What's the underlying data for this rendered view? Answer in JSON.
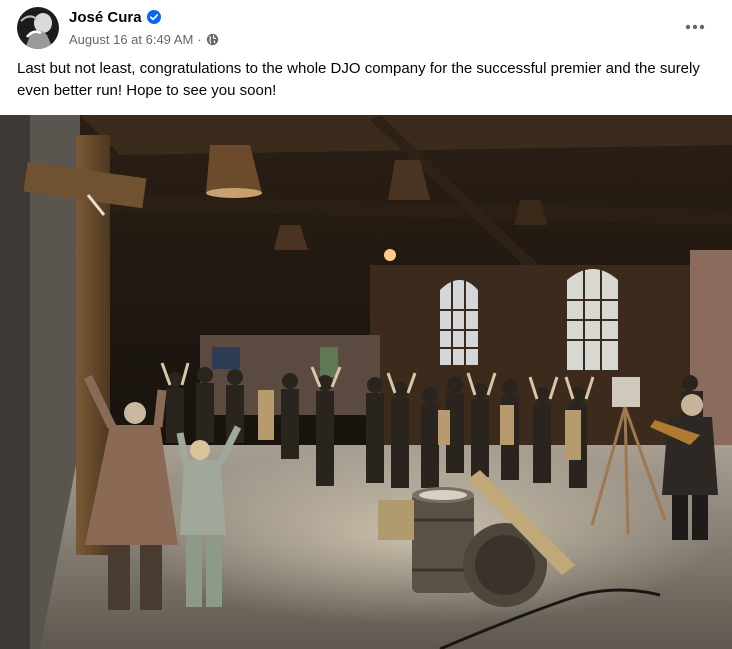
{
  "post": {
    "author": "José Cura",
    "timestamp": "August 16 at 6:49 AM",
    "separator": "·",
    "text": "Last but not least, congratulations to the whole DJO company for the successful premier and the surely even better run! Hope to see you soon!"
  },
  "icons": {
    "verified": "verified-badge-icon",
    "privacy": "globe-icon",
    "more": "more-options-icon"
  },
  "colors": {
    "verified_blue": "#0866ff",
    "meta_gray": "#65676b",
    "text": "#050505"
  }
}
